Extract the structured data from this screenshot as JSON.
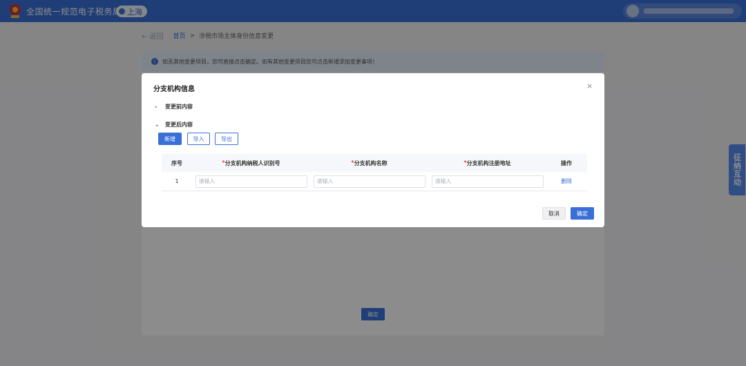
{
  "header": {
    "title": "全国统一规范电子税务局",
    "region": "上海",
    "emblem_icon": "tax-emblem-icon",
    "avatar_icon": "user-avatar-icon"
  },
  "breadcrumb": {
    "back": "← 返回",
    "home": "首页",
    "separator": ">",
    "current": "涉税市场主体身份信息变更"
  },
  "page": {
    "notice": "如无其他变更项目，您可直接点击确定。如有其他变更项目您可点击新增添加变更事项！",
    "confirm_label": "确定"
  },
  "side_widget": {
    "label": "征纳互动"
  },
  "modal": {
    "title": "分支机构信息",
    "close": "×",
    "section_before": "变更前内容",
    "section_after": "变更后内容",
    "buttons": {
      "add": "新增",
      "import": "导入",
      "export": "导出",
      "cancel": "取消",
      "ok": "确定"
    },
    "table": {
      "headers": {
        "index": "序号",
        "tax_id": "分支机构纳税人识别号",
        "name": "分支机构名称",
        "address": "分支机构注册地址",
        "operation": "操作"
      },
      "rows": [
        {
          "index": "1",
          "tax_id_placeholder": "请输入",
          "name_placeholder": "请输入",
          "address_placeholder": "请输入",
          "operation": "删除"
        }
      ]
    }
  },
  "colors": {
    "primary": "#3a6fd8",
    "required": "#e34444"
  }
}
